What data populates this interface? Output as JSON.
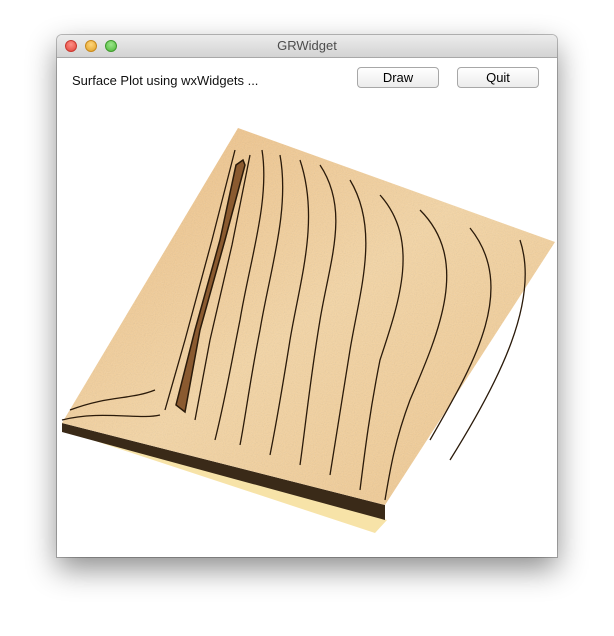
{
  "window": {
    "title": "GRWidget"
  },
  "header": {
    "label": "Surface Plot using wxWidgets ...",
    "draw_label": "Draw",
    "quit_label": "Quit"
  },
  "plot": {
    "type": "surface",
    "colormap": "copper/tan",
    "contours": true,
    "surface_color": "#f2c98e",
    "contour_color": "#2a1a0a",
    "base_color": "#f7e3a8"
  }
}
